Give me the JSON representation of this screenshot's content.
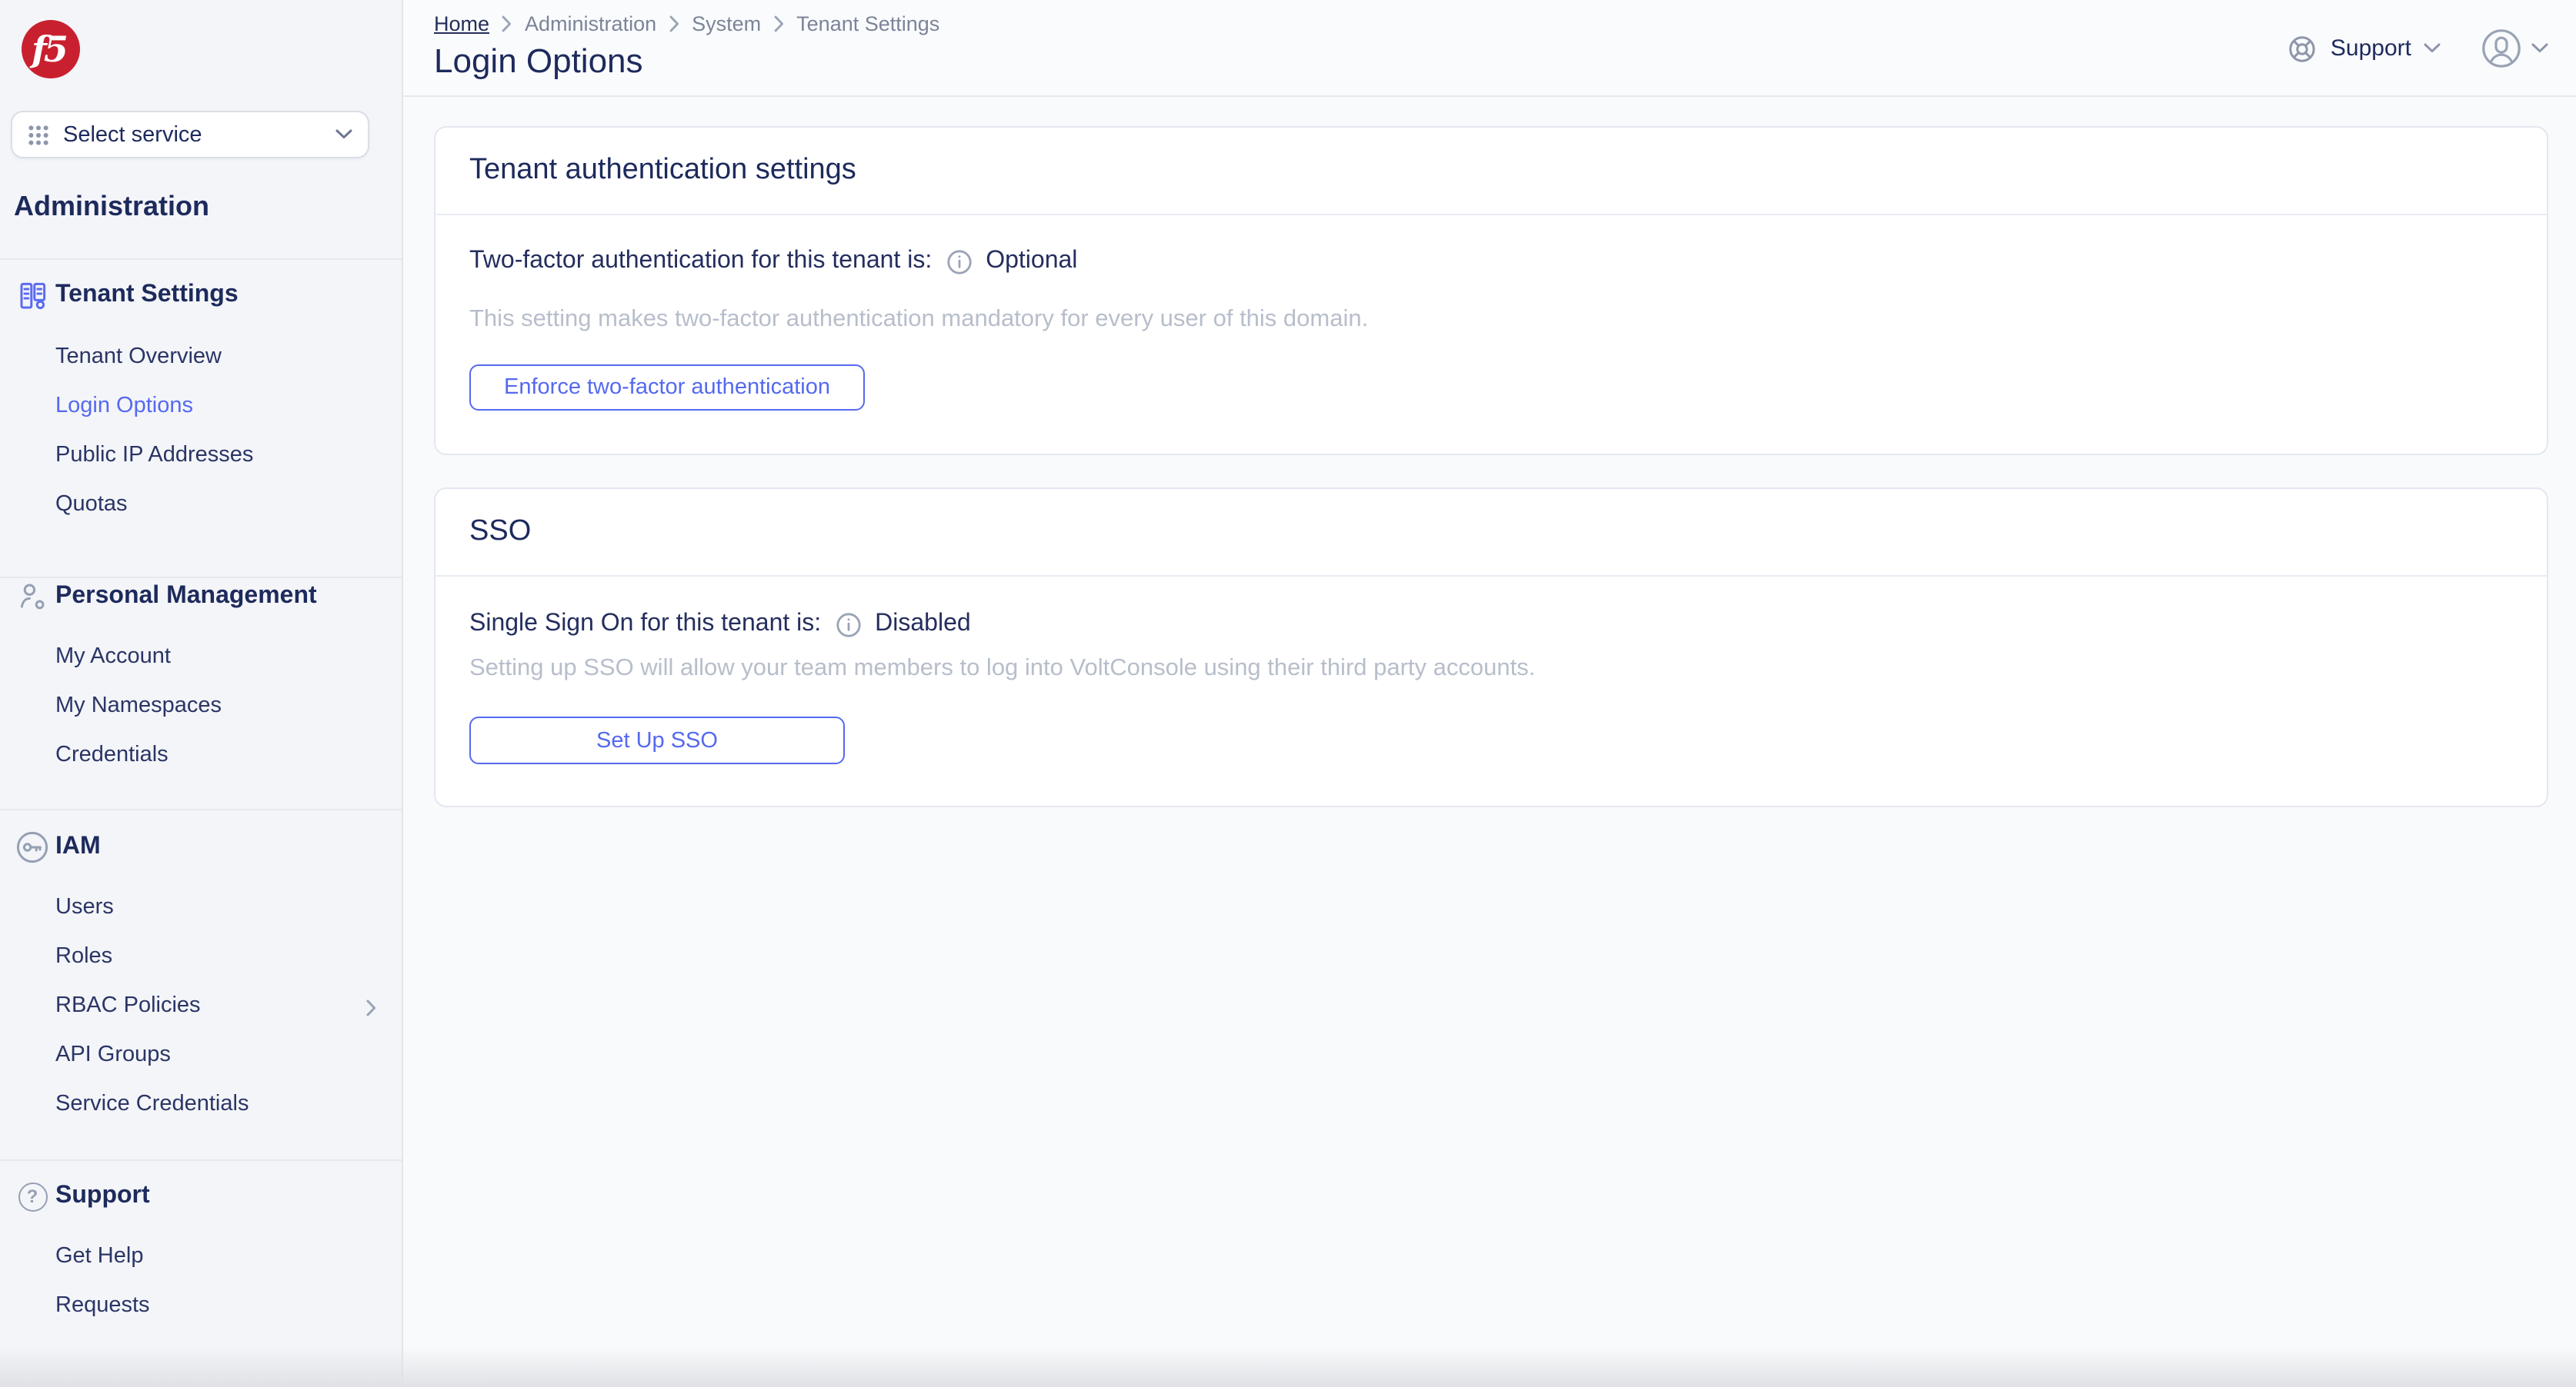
{
  "brand": {
    "logo_text": "f5"
  },
  "sidebar": {
    "service_selector": {
      "label": "Select service"
    },
    "heading": "Administration",
    "sections": [
      {
        "title": "Tenant Settings",
        "icon": "buildings-gear-icon",
        "items": [
          {
            "label": "Tenant Overview",
            "active": false
          },
          {
            "label": "Login Options",
            "active": true
          },
          {
            "label": "Public IP Addresses",
            "active": false
          },
          {
            "label": "Quotas",
            "active": false
          }
        ]
      },
      {
        "title": "Personal Management",
        "icon": "person-gear-icon",
        "items": [
          {
            "label": "My Account"
          },
          {
            "label": "My Namespaces"
          },
          {
            "label": "Credentials"
          }
        ]
      },
      {
        "title": "IAM",
        "icon": "key-icon",
        "items": [
          {
            "label": "Users"
          },
          {
            "label": "Roles"
          },
          {
            "label": "RBAC Policies",
            "has_submenu": true
          },
          {
            "label": "API Groups"
          },
          {
            "label": "Service Credentials"
          }
        ]
      },
      {
        "title": "Support",
        "icon": "help-circle-icon",
        "items": [
          {
            "label": "Get Help"
          },
          {
            "label": "Requests"
          }
        ]
      }
    ]
  },
  "header": {
    "breadcrumb": [
      {
        "label": "Home"
      },
      {
        "label": "Administration"
      },
      {
        "label": "System"
      },
      {
        "label": "Tenant Settings"
      }
    ],
    "page_title": "Login Options",
    "support": {
      "label": "Support"
    }
  },
  "main": {
    "cards": [
      {
        "title": "Tenant authentication settings",
        "status_label": "Two-factor authentication for this tenant is:",
        "status_value": "Optional",
        "description": "This setting makes two-factor authentication mandatory for every user of this domain.",
        "action_label": "Enforce two-factor authentication"
      },
      {
        "title": "SSO",
        "status_label": "Single Sign On for this tenant is:",
        "status_value": "Disabled",
        "description": "Setting up SSO will allow your team members to log into VoltConsole using their third party accounts.",
        "action_label": "Set Up SSO"
      }
    ]
  },
  "colors": {
    "accent": "#5569f0",
    "navy": "#1d2a5c",
    "brand_red": "#c9202f",
    "muted_text": "#7c8498",
    "helper_text": "#b7becb",
    "sidebar_bg": "#f4f5f8",
    "main_bg": "#f9fafb"
  }
}
